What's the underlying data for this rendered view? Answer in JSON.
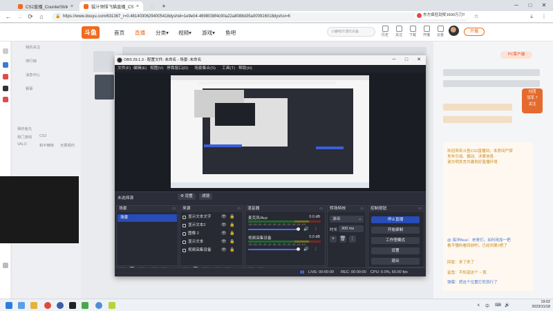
{
  "browser": {
    "tabs": [
      {
        "title": "CS2直播_CounterStrike直播_CS2",
        "close": "×",
        "active": false,
        "fav_color": "#f26a1b"
      },
      {
        "title": "猛汁领悟飞猫直播_CS2直播 -",
        "close": "×",
        "active": true,
        "fav_color": "#f26a1b"
      },
      {
        "title": "",
        "close": "",
        "active": false,
        "fav_color": "#dddddd"
      }
    ],
    "new_tab": "+",
    "window_buttons": [
      "─",
      "□",
      "✕"
    ],
    "nav": {
      "back": "←",
      "forward": "→",
      "reload": "⟳",
      "home": "⌂"
    },
    "lock_icon": "🔒",
    "url": "https://www.douyu.com/631367_r=0.48140306294005418dyshid=1e9e04-4698038f4c90a22a8088d35a000916018dyshci=6",
    "promo": "东方疯狂刮奖1600万刀!!",
    "toolbar_icons": [
      "☆",
      "⤓",
      "⋮"
    ]
  },
  "douyu": {
    "logo": "斗鱼",
    "nav": [
      "首页",
      "直播",
      "分类▾",
      "视频▾",
      "游戏▾",
      "鱼吧"
    ],
    "search_placeholder": "小鹿哈尔滨红白鱼",
    "header_items": [
      "历史",
      "关注",
      "下载",
      "开播",
      "云金"
    ],
    "live_button": "开播",
    "left_menu": [
      "我的关注",
      "排行榜",
      "消息中心",
      "赛事",
      "我的鱼丸",
      "热门游戏",
      "CS2",
      "VALO",
      "和平精英",
      "无畏契约"
    ],
    "pc_badge": "PC客户端",
    "orange_badge": "社团\n冠军 7\n关注",
    "chat_lines": [
      "欢迎来到斗鱼CS2直播间，本房间严禁",
      "发布引战、煽动、涉黄信息",
      "请文明发言共建良好直播环境",
      "@ 海洋Bear：老哥们，如何用加一把",
      "看不懂的看回放吧，已经到第2把了",
      "回复：来了来了",
      "鲨鱼：不知道这个 ~ 我",
      "弹幕：把这个位置打死就行了"
    ]
  },
  "obs": {
    "title": "OBS 29.1.3 - 配置文件: 未命名 - 场景: 未命名",
    "window_buttons": [
      "─",
      "□",
      "✕"
    ],
    "menu": [
      "文件(F)",
      "编辑(E)",
      "视图(V)",
      "停靠窗口(D)",
      "场景集合(S)",
      "工具(T)",
      "帮助(H)"
    ],
    "source_bar": {
      "label": "未选择源",
      "settings": "⚙ 设置",
      "filters": "滤镜"
    },
    "scenes": {
      "title": "场景",
      "items": [
        "场景"
      ],
      "footer": [
        "+",
        "🗑",
        "◧",
        "∧",
        "∨"
      ]
    },
    "sources": {
      "title": "来源",
      "items": [
        "显示文本文字",
        "显示文本2",
        "图像 2",
        "显示文本",
        "视频采集设备"
      ],
      "visibility_icon": "👁",
      "lock_icon": "🔒",
      "footer": [
        "+",
        "🗑",
        "⚙",
        "∧",
        "∨"
      ]
    },
    "mixer": {
      "title": "混音器",
      "channels": [
        {
          "name": "麦克风/Aux",
          "db": "0.0 dB"
        },
        {
          "name": "视频采集设备",
          "db": "0.0 dB"
        }
      ],
      "scale": "-60 -55 -50 -45 -40 -35 -30 -25 -20 -15 -10 -5 0",
      "mute_icon": "🔊",
      "menu_icon": "⋮",
      "footer": [
        "⚙",
        "⋮"
      ]
    },
    "transitions": {
      "title": "转场特效",
      "type": "淡出",
      "duration_label": "时长",
      "duration": "300 ms",
      "footer": [
        "+",
        "🗑",
        "⋮"
      ]
    },
    "controls": {
      "title": "控制按钮",
      "buttons": [
        "停止直播",
        "开始录制",
        "工作室模式",
        "设置",
        "退出"
      ]
    },
    "status": {
      "live": "LIVE: 00:00:00",
      "rec": "REC: 00:00:00",
      "cpu": "CPU: 0.0%, 60.00 fps"
    }
  },
  "taskbar": {
    "clock_time": "19:02",
    "clock_date": "2023/11/18",
    "tray_icons": [
      "∧",
      "中",
      "⌨",
      "🔊"
    ]
  }
}
